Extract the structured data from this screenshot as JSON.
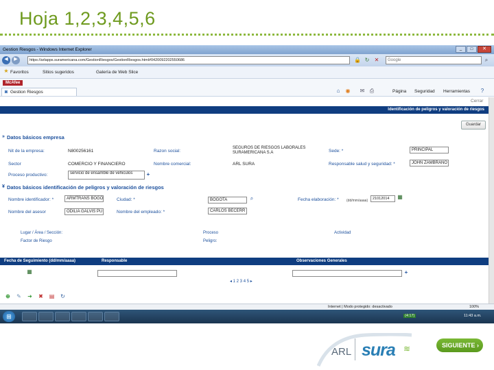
{
  "slide": {
    "title": "Hoja 1,2,3,4,5,6",
    "next_button": "SIGUIENTE",
    "logo_arl": "ARL",
    "logo_sura": "sura"
  },
  "browser": {
    "window_title": "Gestion Riesgos - Windows Internet Explorer",
    "url": "https://arlapps.suramericana.com/GestionRiesgos/GestionRiesgos.html#0420092202550686",
    "search_engine": "Google",
    "toolbar_addon": "McAfee",
    "favorites": [
      "Favoritos",
      "Sitios sugeridos",
      "Galería de Web Slice"
    ],
    "tab_label": "Gestion Riesgos",
    "menu": [
      "Página",
      "Seguridad",
      "Herramientas"
    ],
    "status": "Internet | Modo protegido: desactivado",
    "zoom": "100%"
  },
  "app": {
    "cerrar": "Cerrar",
    "header": "Identificación de peligros y valoración de riesgos",
    "guardar": "Guardar",
    "section1": {
      "title": "Datos básicos empresa",
      "nit_label": "Nit de la empresa:",
      "nit_value": "N800256161",
      "razon_label": "Razon social:",
      "razon_value": "SEGUROS DE RIESGOS LABORALES SURAMERICANA S.A",
      "sede_label": "Sede: *",
      "sede_value": "PRINCIPAL",
      "sector_label": "Sector",
      "sector_value": "COMERCIO Y FINANCIERO",
      "nombre_label": "Nombre comercial:",
      "nombre_value": "ARL SURA",
      "responsable_label": "Responsable salud y seguridad: *",
      "responsable_value": "JOHN ZAMBRANO",
      "proceso_label": "Proceso productivo:",
      "proceso_value": "servicio de ensamble de vehiculos"
    },
    "section2": {
      "title": "Datos básicos identificación de peligros y valoración de riesgos",
      "identificador_label": "Nombre identificador: *",
      "identificador_value": "ARMTRANS BOGO",
      "ciudad_label": "Ciudad: *",
      "ciudad_value": "BOGOTA",
      "fecha_label": "Fecha elaboración: *",
      "fecha_hint": "(dd/mm/aaaa)",
      "fecha_value": "21012014",
      "asesor_label": "Nombre del asesor",
      "asesor_value": "ODILIA GALVIS PU",
      "empleado_label": "Nombre del empleado: *",
      "empleado_value": "CARLOS BECERR"
    },
    "info": {
      "lugar": "Lugar / Área / Sección:",
      "proceso": "Proceso",
      "actividad": "Actividad",
      "factor": "Factor de Riesgo",
      "peligro": "Peligro:"
    },
    "grid": {
      "col1": "Fecha de Seguimiento (dd/mm/aaaa)",
      "col2": "Responsable",
      "col3": "Observaciones Generales",
      "pager": "◂ 1 2 3 4 5 ▸"
    }
  },
  "taskbar": {
    "time": "11:43 a.m.",
    "battery": "(4:17)"
  }
}
